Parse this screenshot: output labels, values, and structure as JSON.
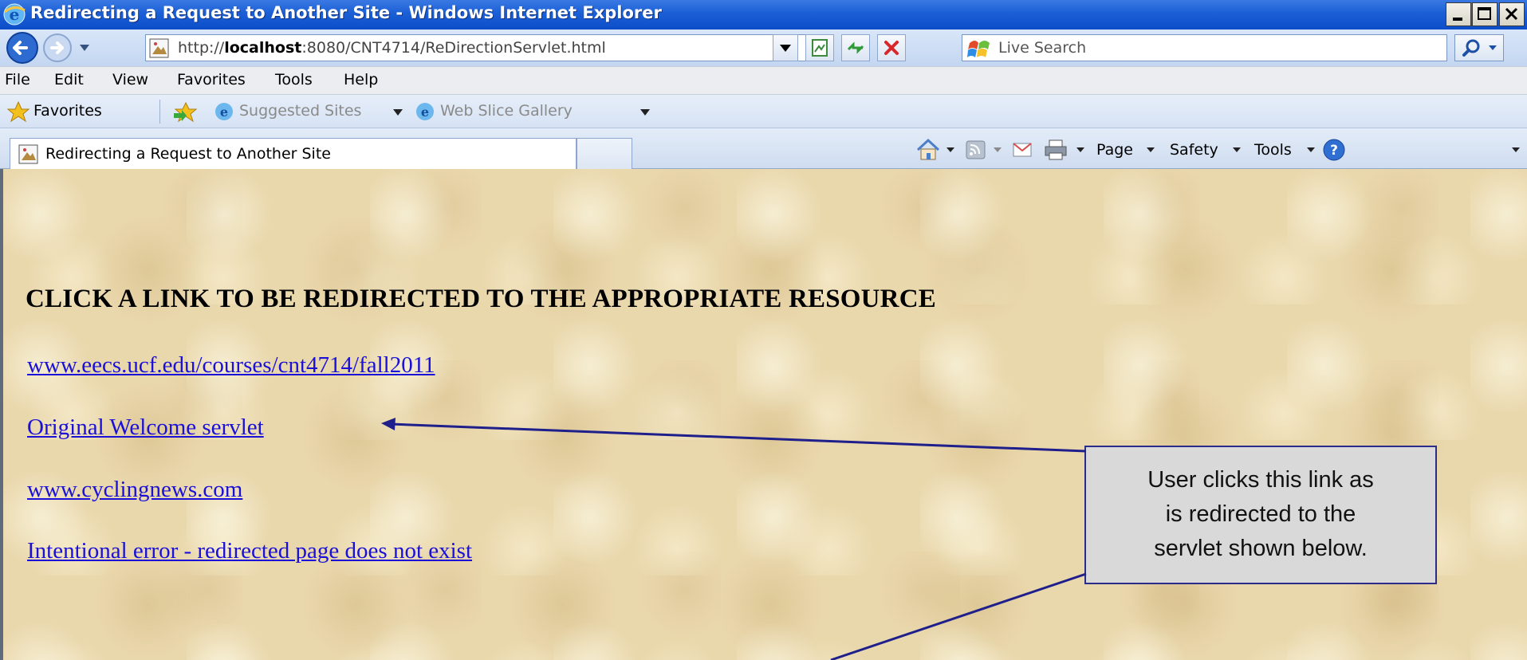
{
  "window": {
    "title": "Redirecting a Request to Another Site - Windows Internet Explorer",
    "icon": "ie-icon"
  },
  "address_bar": {
    "url_prefix": "http://",
    "url_host": "localhost",
    "url_rest": ":8080/CNT4714/ReDirectionServlet.html",
    "search_placeholder": "Live Search"
  },
  "menu": {
    "items": [
      "File",
      "Edit",
      "View",
      "Favorites",
      "Tools",
      "Help"
    ]
  },
  "favorites_bar": {
    "favorites_label": "Favorites",
    "suggested_sites": "Suggested Sites",
    "web_slice_gallery": "Web Slice Gallery"
  },
  "tab": {
    "title": "Redirecting a Request to Another Site"
  },
  "command_bar": {
    "page": "Page",
    "safety": "Safety",
    "tools": "Tools"
  },
  "page": {
    "heading": "CLICK A LINK TO BE REDIRECTED TO THE APPROPRIATE RESOURCE",
    "links": [
      "www.eecs.ucf.edu/courses/cnt4714/fall2011",
      "Original Welcome servlet",
      "www.cyclingnews.com",
      "Intentional error - redirected page does not exist"
    ]
  },
  "callout": {
    "lines": [
      "User clicks this link as",
      "is redirected to the",
      "servlet shown below."
    ]
  },
  "colors": {
    "titlebar": "#1b5fd6",
    "link": "#1a10d8",
    "page_background": "#ead8ad",
    "callout_fill": "#d9d9d9",
    "callout_border": "#2b2b8a",
    "arrow": "#1f1f8c"
  }
}
